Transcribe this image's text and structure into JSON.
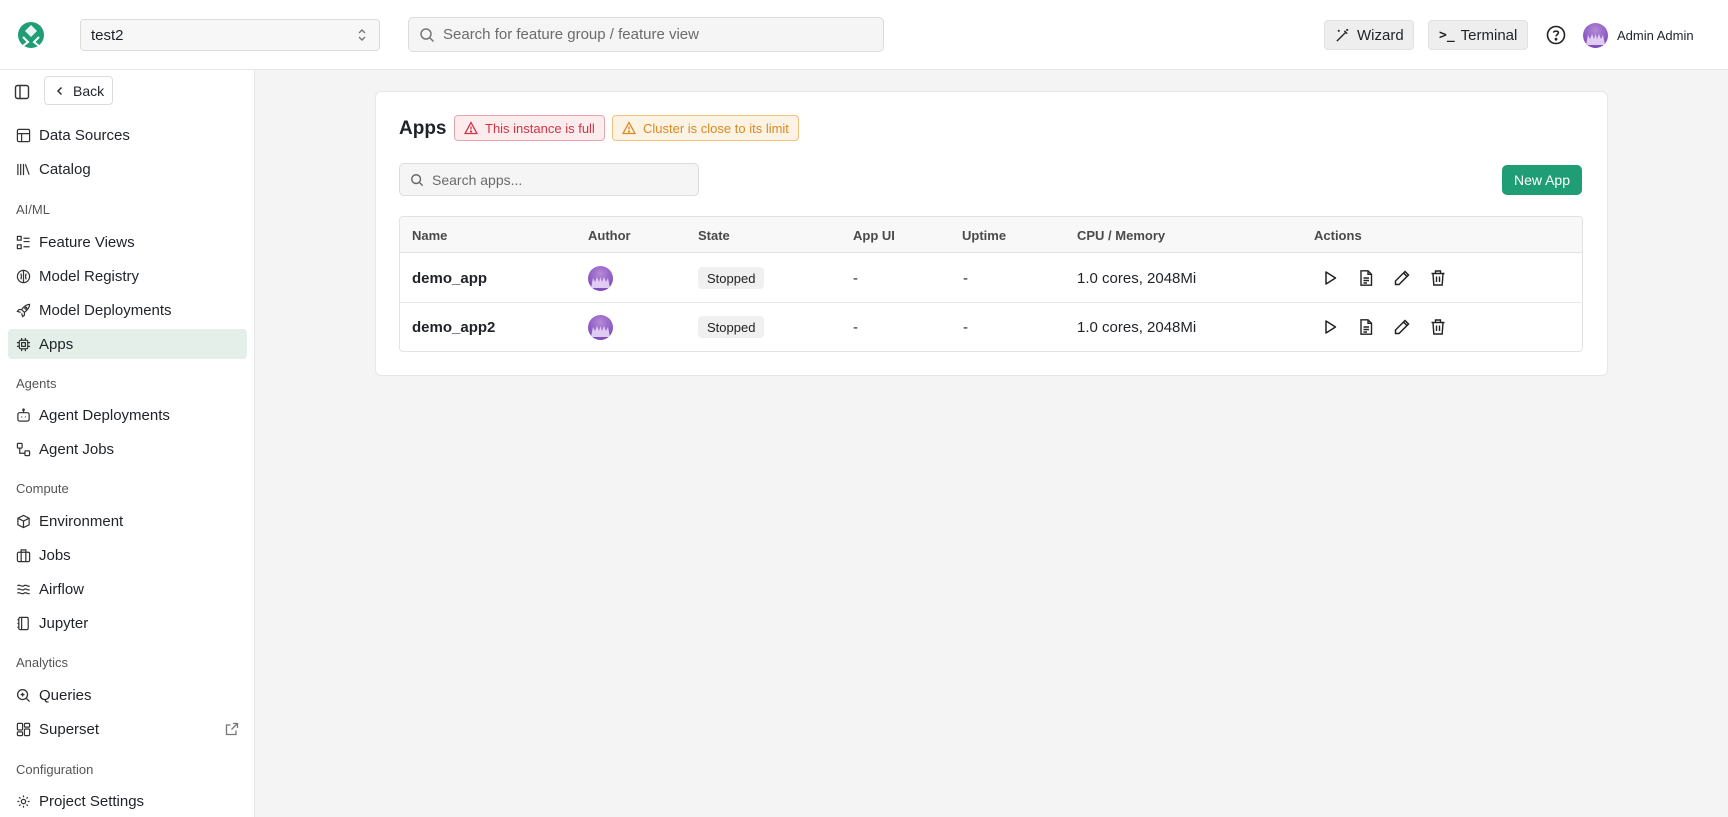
{
  "header": {
    "project": "test2",
    "search_placeholder": "Search for feature group / feature view",
    "wizard_label": "Wizard",
    "terminal_prompt": ">_",
    "terminal_label": "Terminal",
    "user_name": "Admin Admin"
  },
  "sidebar": {
    "back_label": "Back",
    "items_top": [
      {
        "label": "Data Sources",
        "icon": "table-icon"
      },
      {
        "label": "Catalog",
        "icon": "library-icon"
      }
    ],
    "sections": {
      "aiml": "AI/ML",
      "agents": "Agents",
      "compute": "Compute",
      "analytics": "Analytics",
      "configuration": "Configuration"
    },
    "aiml_items": [
      {
        "label": "Feature Views",
        "icon": "list-icon"
      },
      {
        "label": "Model Registry",
        "icon": "brain-icon"
      },
      {
        "label": "Model Deployments",
        "icon": "rocket-icon"
      },
      {
        "label": "Apps",
        "icon": "chip-icon",
        "active": true
      }
    ],
    "agents_items": [
      {
        "label": "Agent Deployments",
        "icon": "bot-icon"
      },
      {
        "label": "Agent Jobs",
        "icon": "workflow-icon"
      }
    ],
    "compute_items": [
      {
        "label": "Environment",
        "icon": "cube-icon"
      },
      {
        "label": "Jobs",
        "icon": "briefcase-icon"
      },
      {
        "label": "Airflow",
        "icon": "wind-icon"
      },
      {
        "label": "Jupyter",
        "icon": "notebook-icon"
      }
    ],
    "analytics_items": [
      {
        "label": "Queries",
        "icon": "search-zoom-icon"
      },
      {
        "label": "Superset",
        "icon": "dashboard-icon"
      }
    ],
    "config_items": [
      {
        "label": "Project Settings",
        "icon": "gear-icon"
      }
    ]
  },
  "main": {
    "title": "Apps",
    "badge_error": "This instance is full",
    "badge_warn": "Cluster is close to its limit",
    "search_placeholder": "Search apps...",
    "new_app_label": "New App",
    "columns": [
      "Name",
      "Author",
      "State",
      "App UI",
      "Uptime",
      "CPU / Memory",
      "Actions"
    ],
    "rows": [
      {
        "name": "demo_app",
        "state": "Stopped",
        "app_ui": "-",
        "uptime": "-",
        "cpu_memory": "1.0 cores, 2048Mi"
      },
      {
        "name": "demo_app2",
        "state": "Stopped",
        "app_ui": "-",
        "uptime": "-",
        "cpu_memory": "1.0 cores, 2048Mi"
      }
    ]
  },
  "colors": {
    "brand": "#1f9d75",
    "active_nav": "#e4efea",
    "error": "#d03444",
    "warning": "#d88a1f"
  }
}
